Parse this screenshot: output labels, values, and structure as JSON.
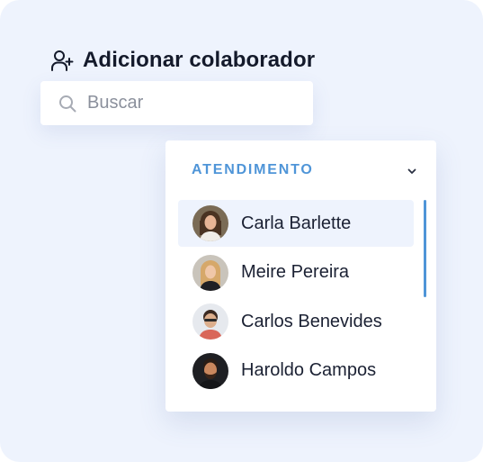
{
  "header": {
    "title": "Adicionar colaborador",
    "icon": "add-user-icon"
  },
  "search": {
    "placeholder": "Buscar",
    "value": "",
    "icon": "search-icon"
  },
  "dropdown": {
    "title": "ATENDIMENTO",
    "expanded": true,
    "chevron_icon": "chevron-down-icon",
    "accent_color": "#4f95d8",
    "items": [
      {
        "name": "Carla Barlette",
        "selected": true
      },
      {
        "name": "Meire Pereira",
        "selected": false
      },
      {
        "name": "Carlos Benevides",
        "selected": false
      },
      {
        "name": "Haroldo Campos",
        "selected": false
      }
    ]
  },
  "colors": {
    "background": "#eef3fd",
    "title_text": "#141a2b",
    "accent": "#4f95d8",
    "selected_row": "#eef3fd"
  }
}
